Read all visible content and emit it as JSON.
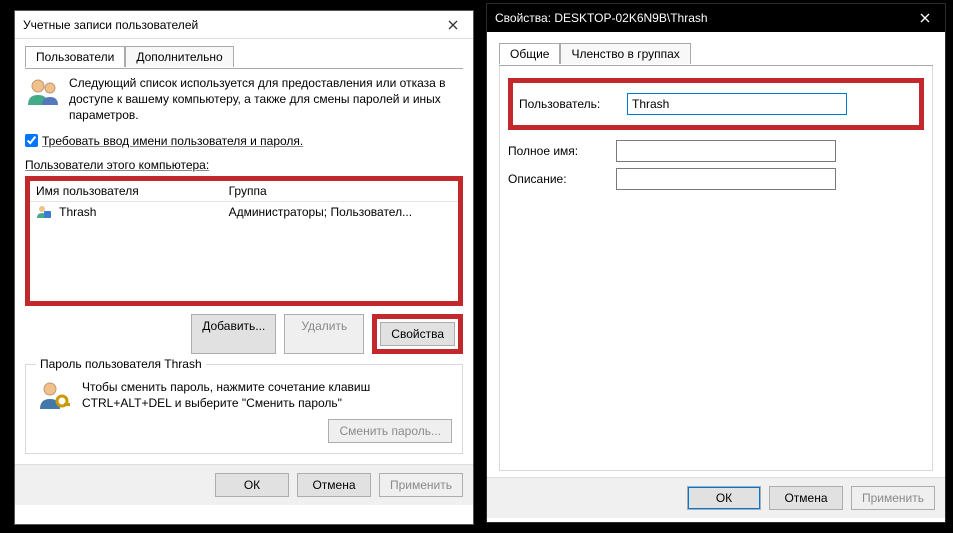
{
  "left": {
    "title": "Учетные записи пользователей",
    "tabs": {
      "users": "Пользователи",
      "advanced": "Дополнительно"
    },
    "description": "Следующий список используется для предоставления или отказа в доступе к вашему компьютеру, а также для смены паролей и иных параметров.",
    "require_label": "Требовать ввод имени пользователя и пароля.",
    "require_checked": true,
    "list_label": "Пользователи этого компьютера:",
    "columns": {
      "user": "Имя пользователя",
      "group": "Группа"
    },
    "rows": [
      {
        "user": "Thrash",
        "group": "Администраторы; Пользовател..."
      }
    ],
    "buttons": {
      "add": "Добавить...",
      "remove": "Удалить",
      "properties": "Свойства"
    },
    "pw_legend": "Пароль пользователя Thrash",
    "pw_text": "Чтобы сменить пароль, нажмите сочетание клавиш CTRL+ALT+DEL и выберите \"Сменить пароль\"",
    "pw_button": "Сменить пароль...",
    "footer": {
      "ok": "ОК",
      "cancel": "Отмена",
      "apply": "Применить"
    }
  },
  "right": {
    "title": "Свойства: DESKTOP-02K6N9B\\Thrash",
    "tabs": {
      "general": "Общие",
      "membership": "Членство в группах"
    },
    "fields": {
      "user_label": "Пользователь:",
      "user_value": "Thrash",
      "fullname_label": "Полное имя:",
      "fullname_value": "",
      "desc_label": "Описание:",
      "desc_value": ""
    },
    "footer": {
      "ok": "ОК",
      "cancel": "Отмена",
      "apply": "Применить"
    }
  }
}
